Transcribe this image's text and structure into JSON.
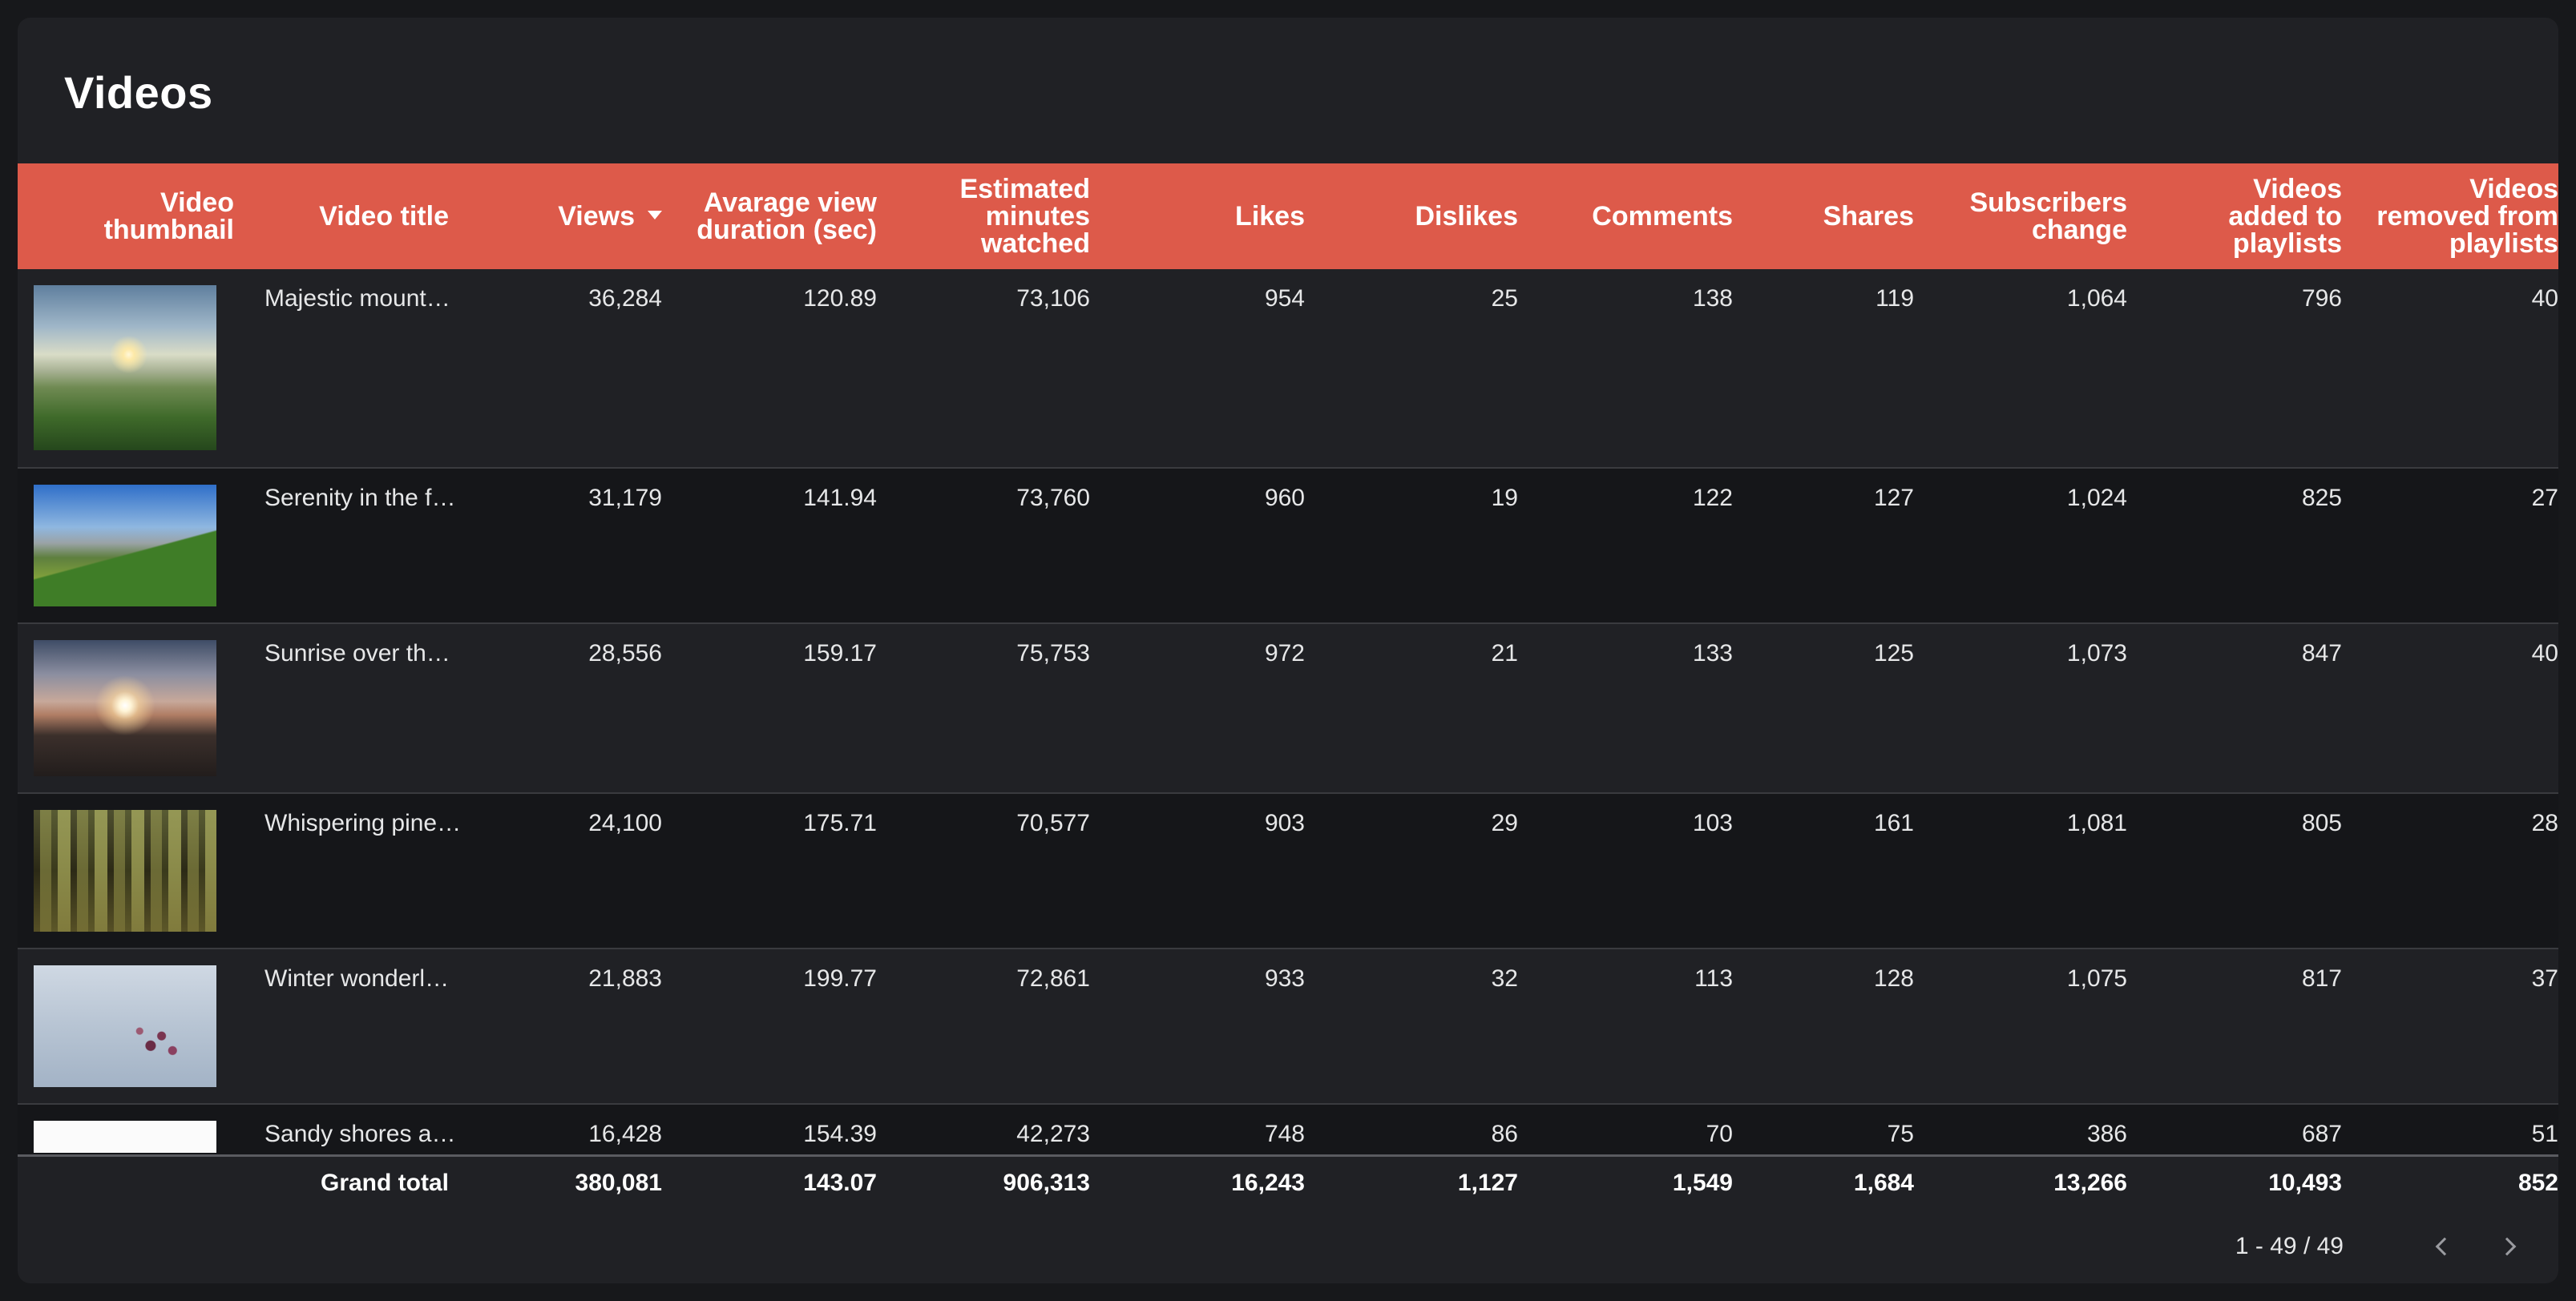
{
  "title": "Videos",
  "columns": [
    "Video thumbnail",
    "Video title",
    "Views",
    "Avarage view duration (sec)",
    "Estimated minutes watched",
    "Likes",
    "Dislikes",
    "Comments",
    "Shares",
    "Subscribers change",
    "Videos added to playlists",
    "Videos removed from playlists"
  ],
  "sort": {
    "column": "Views",
    "direction": "descending",
    "icon": "sort-desc-icon"
  },
  "rows": [
    {
      "thumbnail": "mountain-sunrise-image",
      "title": "Majestic mount…",
      "views": "36,284",
      "avg_duration": "120.89",
      "minutes": "73,106",
      "likes": "954",
      "dislikes": "25",
      "comments": "138",
      "shares": "119",
      "subs": "1,064",
      "added": "796",
      "removed": "40"
    },
    {
      "thumbnail": "meadow-forest-image",
      "title": "Serenity in the f…",
      "views": "31,179",
      "avg_duration": "141.94",
      "minutes": "73,760",
      "likes": "960",
      "dislikes": "19",
      "comments": "122",
      "shares": "127",
      "subs": "1,024",
      "added": "825",
      "removed": "27"
    },
    {
      "thumbnail": "sunset-sea-image",
      "title": "Sunrise over th…",
      "views": "28,556",
      "avg_duration": "159.17",
      "minutes": "75,753",
      "likes": "972",
      "dislikes": "21",
      "comments": "133",
      "shares": "125",
      "subs": "1,073",
      "added": "847",
      "removed": "40"
    },
    {
      "thumbnail": "pine-forest-image",
      "title": "Whispering pine…",
      "views": "24,100",
      "avg_duration": "175.71",
      "minutes": "70,577",
      "likes": "903",
      "dislikes": "29",
      "comments": "103",
      "shares": "161",
      "subs": "1,081",
      "added": "805",
      "removed": "28"
    },
    {
      "thumbnail": "winter-berries-image",
      "title": "Winter wonderl…",
      "views": "21,883",
      "avg_duration": "199.77",
      "minutes": "72,861",
      "likes": "933",
      "dislikes": "32",
      "comments": "113",
      "shares": "128",
      "subs": "1,075",
      "added": "817",
      "removed": "37"
    },
    {
      "thumbnail": "sandy-beach-image",
      "title": "Sandy shores a…",
      "views": "16,428",
      "avg_duration": "154.39",
      "minutes": "42,273",
      "likes": "748",
      "dislikes": "86",
      "comments": "70",
      "shares": "75",
      "subs": "386",
      "added": "687",
      "removed": "51"
    }
  ],
  "totals": {
    "label": "Grand total",
    "views": "380,081",
    "avg_duration": "143.07",
    "minutes": "906,313",
    "likes": "16,243",
    "dislikes": "1,127",
    "comments": "1,549",
    "shares": "1,684",
    "subs": "13,266",
    "added": "10,493",
    "removed": "852"
  },
  "pagination": {
    "range": "1 - 49 / 49",
    "prev_icon": "chevron-left-icon",
    "next_icon": "chevron-right-icon"
  },
  "colors": {
    "header_bg": "#dd5a4a",
    "card_bg": "#202125",
    "page_bg": "#17181b"
  }
}
